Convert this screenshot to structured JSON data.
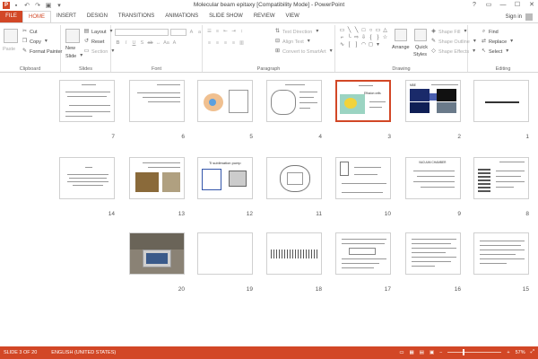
{
  "window": {
    "title": "Molecular beam epitaxy [Compatibility Mode] - PowerPoint",
    "app_icon": "P",
    "controls": [
      "?",
      "▭",
      "—",
      "☐",
      "✕"
    ]
  },
  "qat": [
    "save-icon",
    "undo-icon",
    "redo-icon",
    "slideshow-icon",
    "customize-icon"
  ],
  "tabs": [
    {
      "label": "FILE"
    },
    {
      "label": "HOME"
    },
    {
      "label": "INSERT"
    },
    {
      "label": "DESIGN"
    },
    {
      "label": "TRANSITIONS"
    },
    {
      "label": "ANIMATIONS"
    },
    {
      "label": "SLIDE SHOW"
    },
    {
      "label": "REVIEW"
    },
    {
      "label": "VIEW"
    }
  ],
  "signin": "Sign in",
  "ribbon": {
    "clipboard": {
      "label": "Clipboard",
      "paste": "Paste",
      "cut": "Cut",
      "copy": "Copy",
      "format_painter": "Format Painter"
    },
    "slides": {
      "label": "Slides",
      "new_slide": "New",
      "new_slide2": "Slide",
      "layout": "Layout",
      "reset": "Reset",
      "section": "Section"
    },
    "font": {
      "label": "Font"
    },
    "paragraph": {
      "label": "Paragraph",
      "text_direction": "Text Direction",
      "align_text": "Align Text",
      "convert_smartart": "Convert to SmartArt"
    },
    "drawing": {
      "label": "Drawing",
      "arrange": "Arrange",
      "quick_styles": "Quick",
      "quick_styles2": "Styles",
      "shape_fill": "Shape Fill",
      "shape_outline": "Shape Outline",
      "shape_effects": "Shape Effects"
    },
    "editing": {
      "label": "Editing",
      "find": "Find",
      "replace": "Replace",
      "select": "Select"
    }
  },
  "slides": [
    {
      "num": "1",
      "selected": false
    },
    {
      "num": "2",
      "selected": false
    },
    {
      "num": "3",
      "selected": true
    },
    {
      "num": "4",
      "selected": false
    },
    {
      "num": "5",
      "selected": false
    },
    {
      "num": "6",
      "selected": false
    },
    {
      "num": "7",
      "selected": false
    },
    {
      "num": "8",
      "selected": false
    },
    {
      "num": "9",
      "selected": false
    },
    {
      "num": "10",
      "selected": false
    },
    {
      "num": "11",
      "selected": false
    },
    {
      "num": "12",
      "selected": false
    },
    {
      "num": "13",
      "selected": false
    },
    {
      "num": "14",
      "selected": false
    },
    {
      "num": "15",
      "selected": false
    },
    {
      "num": "16",
      "selected": false
    },
    {
      "num": "17",
      "selected": false
    },
    {
      "num": "18",
      "selected": false
    },
    {
      "num": "19",
      "selected": false
    },
    {
      "num": "20",
      "selected": false
    }
  ],
  "slide_texts": {
    "s9_title": "VACUUM CHAMBER",
    "s12_title": "Ti sublimation pump",
    "s3_title": "Effusion cells",
    "s2_title": "MBE"
  },
  "status": {
    "slide": "SLIDE 3 OF 20",
    "language": "ENGLISH (UNITED STATES)",
    "zoom": "57%",
    "zoom_fraction": 0.57
  }
}
